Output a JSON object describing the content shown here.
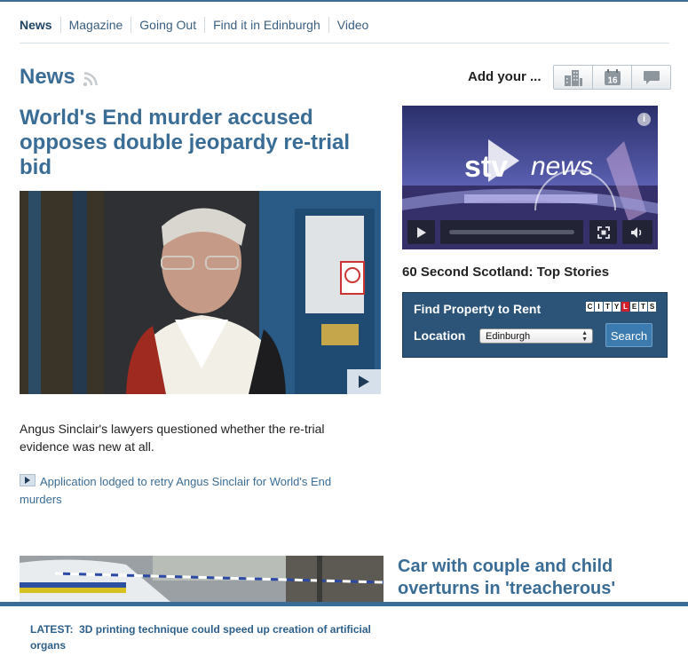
{
  "nav": {
    "items": [
      "News",
      "Magazine",
      "Going Out",
      "Find it in Edinburgh",
      "Video"
    ]
  },
  "section": {
    "title": "News"
  },
  "add_your": {
    "label": "Add your ...",
    "calendar_day": "16",
    "icons": [
      "buildings-icon",
      "calendar-icon",
      "comment-icon"
    ]
  },
  "main_story": {
    "headline": "World's End murder accused opposes double jeopardy re-trial bid",
    "summary": "Angus Sinclair's lawyers questioned whether the re-trial evidence was new at all.",
    "related_link": "Application lodged to retry Angus Sinclair for World's End murders"
  },
  "video": {
    "logo_stv": "stv",
    "logo_news": "news",
    "caption": "60 Second Scotland: Top Stories"
  },
  "property": {
    "title": "Find Property to Rent",
    "brand_letters": [
      "C",
      "I",
      "T",
      "Y",
      "L",
      "E",
      "T",
      "S"
    ],
    "location_label": "Location",
    "location_value": "Edinburgh",
    "search_label": "Search"
  },
  "second_story": {
    "headline": "Car with couple and child overturns in 'treacherous'"
  },
  "latest": {
    "label": "LATEST:",
    "text": "3D printing technique could speed up creation of artificial organs"
  },
  "colors": {
    "brand_blue": "#3a6d96",
    "widget_blue": "#2c5478",
    "text": "#222222"
  }
}
